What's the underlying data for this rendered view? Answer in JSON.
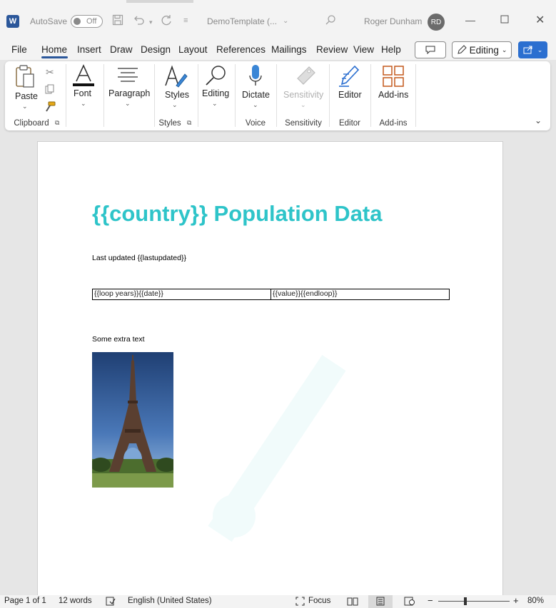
{
  "titlebar": {
    "autosave_label": "AutoSave",
    "autosave_state": "Off",
    "doc_name": "DemoTemplate (...",
    "user_name": "Roger Dunham",
    "user_initials": "RD",
    "app_letter": "W"
  },
  "menu": {
    "items": [
      "File",
      "Home",
      "Insert",
      "Draw",
      "Design",
      "Layout",
      "References",
      "Mailings",
      "Review",
      "View",
      "Help"
    ],
    "active": "Home",
    "editing_label": "Editing"
  },
  "ribbon": {
    "paste": "Paste",
    "font": "Font",
    "paragraph": "Paragraph",
    "styles": "Styles",
    "editing": "Editing",
    "dictate": "Dictate",
    "sensitivity": "Sensitivity",
    "editor": "Editor",
    "addins": "Add-ins",
    "groups": {
      "clipboard": "Clipboard",
      "styles": "Styles",
      "voice": "Voice",
      "sensitivity": "Sensitivity",
      "editor": "Editor",
      "addins": "Add-ins"
    }
  },
  "document": {
    "title": "{{country}} Population Data",
    "last_updated": "Last updated {{lastupdated}}",
    "table_row": [
      "{{loop years}}{{date}}",
      "{{value}}{{endloop}}"
    ],
    "extra_text": "Some extra text",
    "title_color": "#2ec4c9"
  },
  "statusbar": {
    "page": "Page 1 of 1",
    "words": "12 words",
    "language": "English (United States)",
    "focus": "Focus",
    "zoom": "80%"
  },
  "colors": {
    "accent": "#2b579a",
    "share": "#2b6fd0"
  }
}
